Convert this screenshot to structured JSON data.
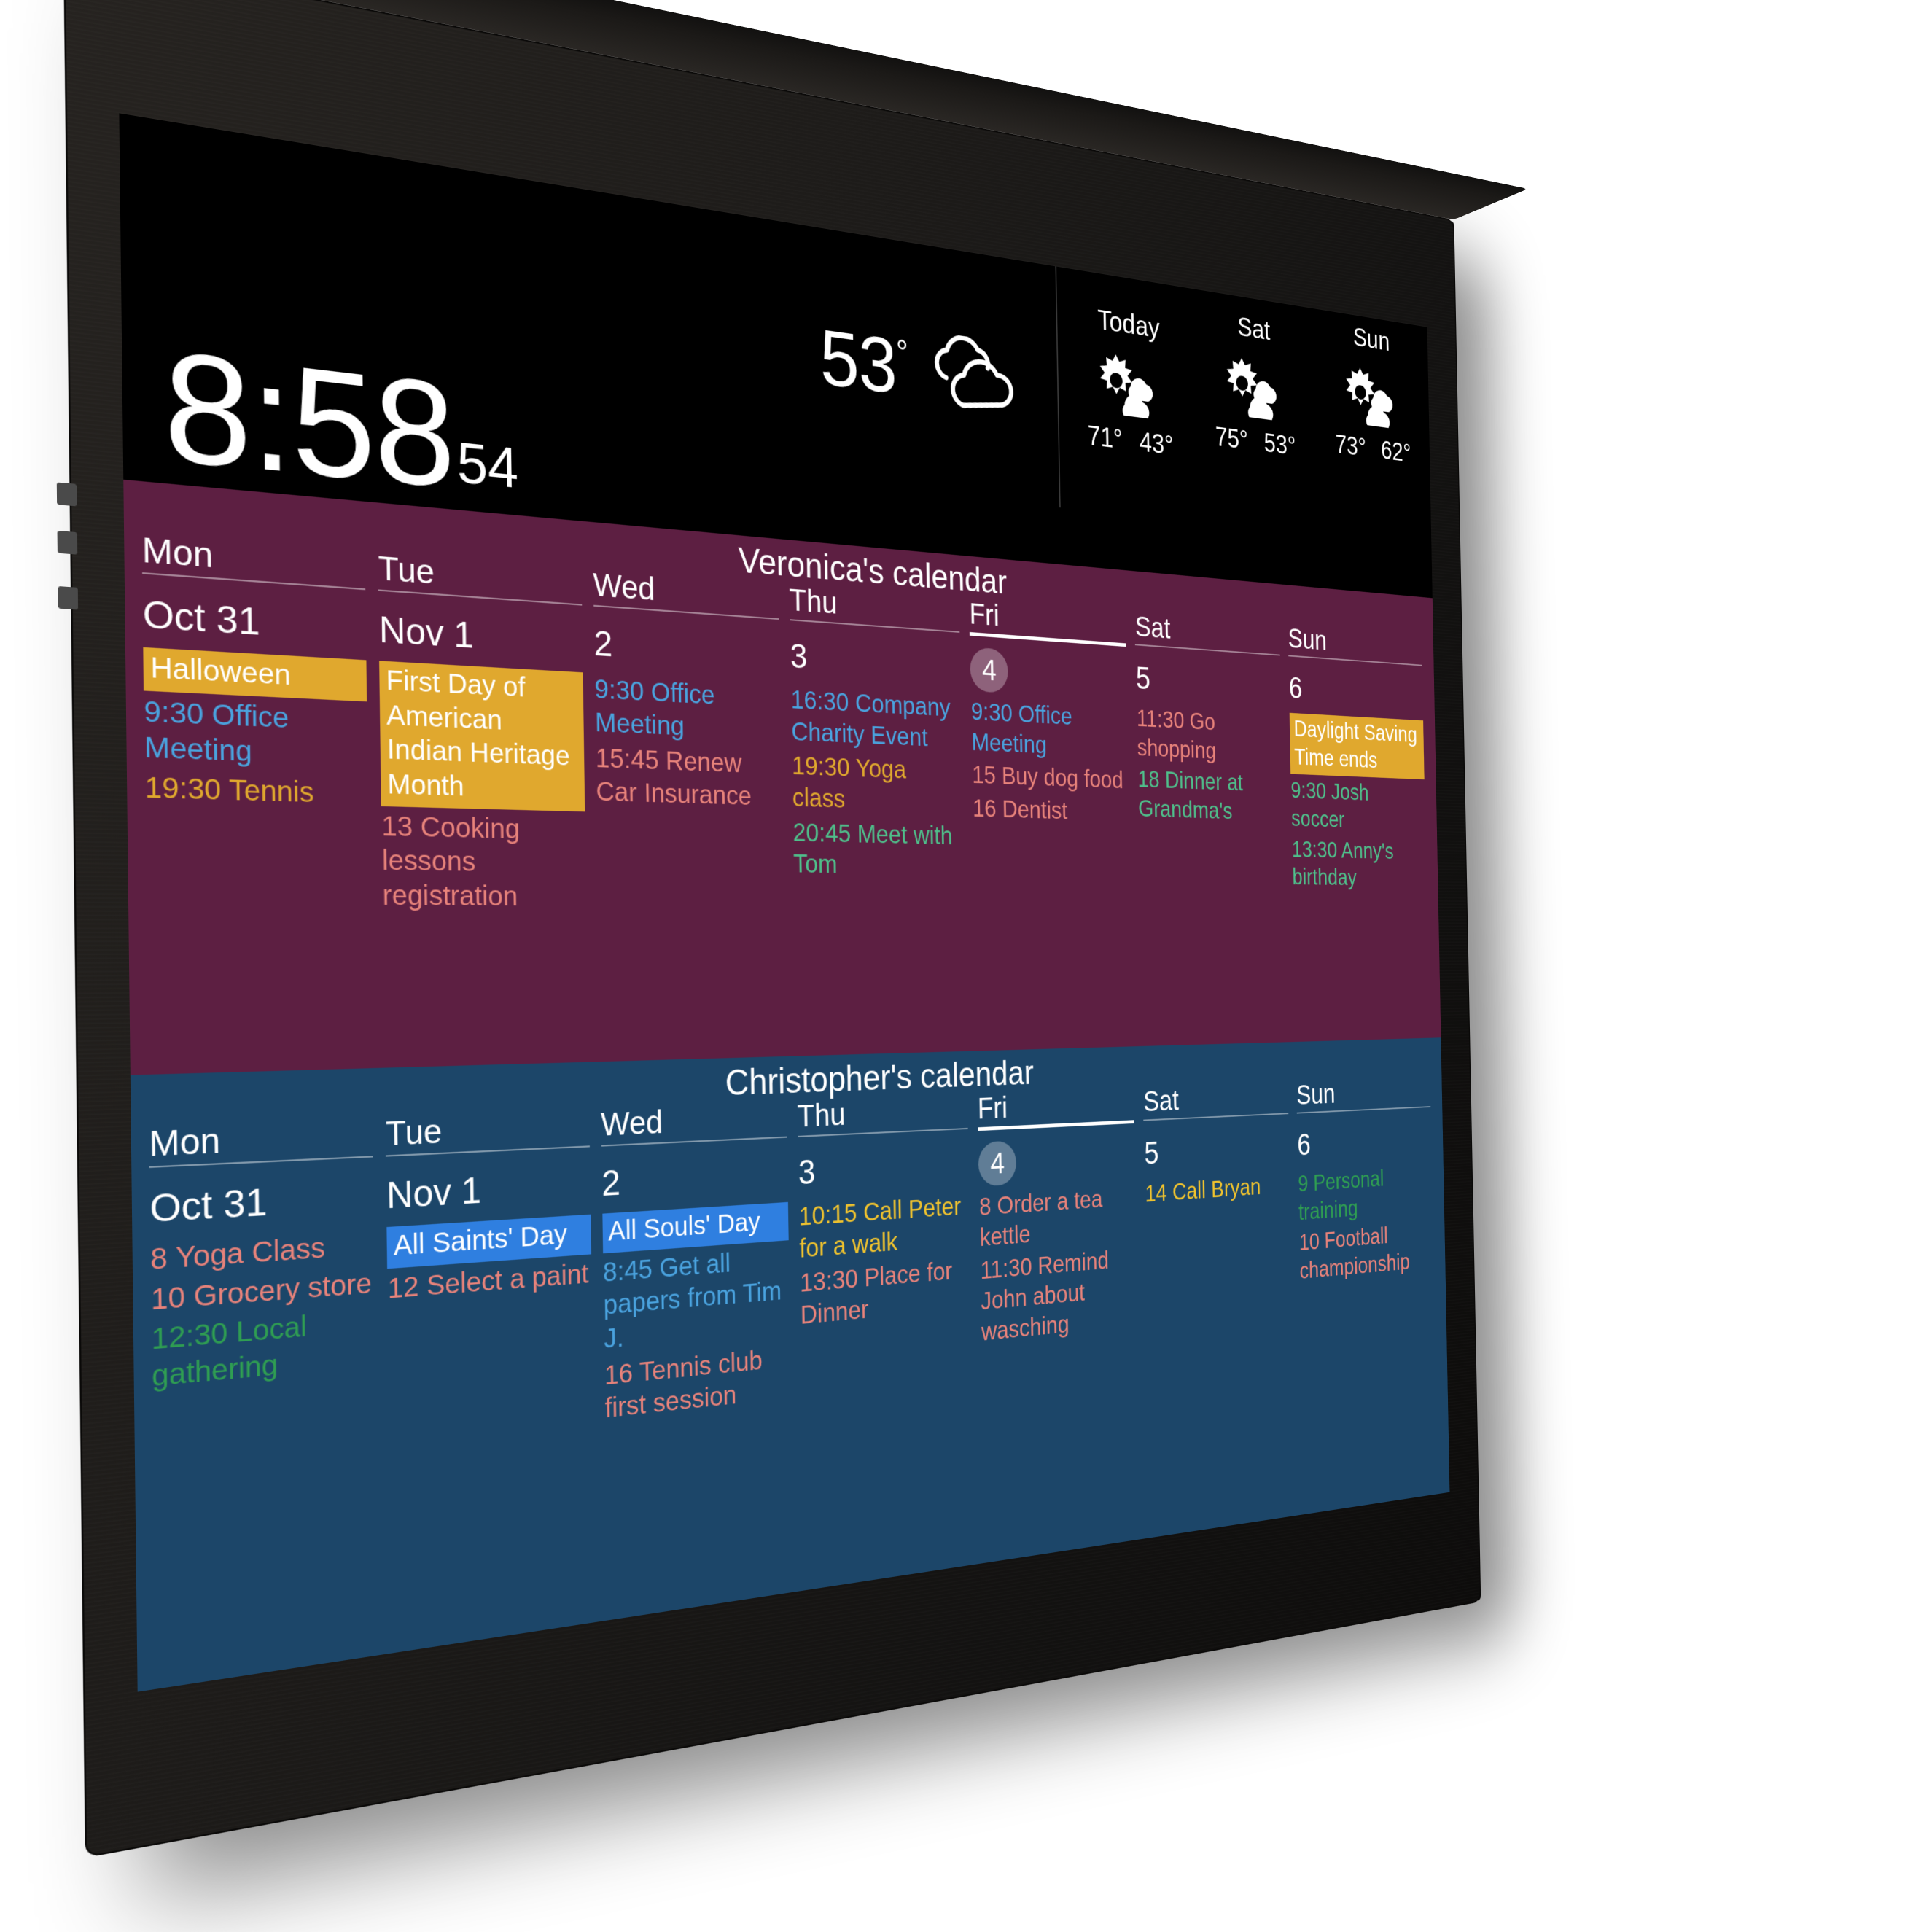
{
  "device": {
    "type": "wall-mounted-smart-display",
    "frame_color": "#1b1917"
  },
  "statusbar": {
    "clock": {
      "time": "8:58",
      "seconds": "54"
    },
    "current_weather": {
      "temperature": "53",
      "degree": "°",
      "icon": "cloudy-icon"
    },
    "forecast": [
      {
        "day": "Today",
        "icon": "partly-cloudy-icon",
        "high": "71°",
        "low": "43°"
      },
      {
        "day": "Sat",
        "icon": "partly-cloudy-icon",
        "high": "75°",
        "low": "53°"
      },
      {
        "day": "Sun",
        "icon": "partly-cloudy-icon",
        "high": "73°",
        "low": "62°"
      }
    ]
  },
  "calendars": [
    {
      "title": "Veronica's calendar",
      "accent": "#5d1f42",
      "days": [
        {
          "dow": "Mon",
          "date": "Oct 31",
          "today": false,
          "events": [
            {
              "text": "Halloween",
              "style": "chip-amber"
            },
            {
              "text": "9:30 Office Meeting",
              "style": "c-blue"
            },
            {
              "text": "19:30 Tennis",
              "style": "c-amber"
            }
          ]
        },
        {
          "dow": "Tue",
          "date": "Nov 1",
          "today": false,
          "events": [
            {
              "text": "First Day of American Indian Heritage Month",
              "style": "chip-amber"
            },
            {
              "text": "13 Cooking lessons registration",
              "style": "c-red"
            }
          ]
        },
        {
          "dow": "Wed",
          "date": "2",
          "today": false,
          "events": [
            {
              "text": "9:30 Office Meeting",
              "style": "c-blue"
            },
            {
              "text": "15:45 Renew Car Insurance",
              "style": "c-red"
            }
          ]
        },
        {
          "dow": "Thu",
          "date": "3",
          "today": false,
          "events": [
            {
              "text": "16:30 Company Charity Event",
              "style": "c-blue"
            },
            {
              "text": "19:30 Yoga class",
              "style": "c-amber"
            },
            {
              "text": "20:45 Meet with Tom",
              "style": "c-green"
            }
          ]
        },
        {
          "dow": "Fri",
          "date": "4",
          "today": true,
          "events": [
            {
              "text": "9:30 Office Meeting",
              "style": "c-blue"
            },
            {
              "text": "15 Buy dog food",
              "style": "c-red"
            },
            {
              "text": "16 Dentist",
              "style": "c-red"
            }
          ]
        },
        {
          "dow": "Sat",
          "date": "5",
          "today": false,
          "events": [
            {
              "text": "11:30 Go shopping",
              "style": "c-red"
            },
            {
              "text": "18 Dinner at Grandma's",
              "style": "c-green"
            }
          ]
        },
        {
          "dow": "Sun",
          "date": "6",
          "today": false,
          "events": [
            {
              "text": "Daylight Saving Time ends",
              "style": "chip-amber"
            },
            {
              "text": "9:30 Josh soccer",
              "style": "c-green"
            },
            {
              "text": "13:30 Anny's birthday",
              "style": "c-green"
            }
          ]
        }
      ]
    },
    {
      "title": "Christopher's calendar",
      "accent": "#1c4669",
      "days": [
        {
          "dow": "Mon",
          "date": "Oct 31",
          "today": false,
          "events": [
            {
              "text": "8 Yoga Class",
              "style": "c-red"
            },
            {
              "text": "10 Grocery store",
              "style": "c-red"
            },
            {
              "text": "12:30 Local gathering",
              "style": "c-green2"
            }
          ]
        },
        {
          "dow": "Tue",
          "date": "Nov 1",
          "today": false,
          "events": [
            {
              "text": "All Saints' Day",
              "style": "chip-blue"
            },
            {
              "text": "12 Select a paint",
              "style": "c-red"
            }
          ]
        },
        {
          "dow": "Wed",
          "date": "2",
          "today": false,
          "events": [
            {
              "text": "All Souls' Day",
              "style": "chip-blue"
            },
            {
              "text": "8:45 Get all papers from Tim J.",
              "style": "c-blue"
            },
            {
              "text": "16 Tennis club first session",
              "style": "c-red"
            }
          ]
        },
        {
          "dow": "Thu",
          "date": "3",
          "today": false,
          "events": [
            {
              "text": "10:15 Call Peter for a walk",
              "style": "c-yellow"
            },
            {
              "text": "13:30 Place for Dinner",
              "style": "c-red"
            }
          ]
        },
        {
          "dow": "Fri",
          "date": "4",
          "today": true,
          "events": [
            {
              "text": "8 Order a tea kettle",
              "style": "c-red"
            },
            {
              "text": "11:30 Remind John about wasching",
              "style": "c-red"
            }
          ]
        },
        {
          "dow": "Sat",
          "date": "5",
          "today": false,
          "events": [
            {
              "text": "14 Call Bryan",
              "style": "c-yellow"
            }
          ]
        },
        {
          "dow": "Sun",
          "date": "6",
          "today": false,
          "events": [
            {
              "text": "9 Personal training",
              "style": "c-green2"
            },
            {
              "text": "10 Football championship",
              "style": "c-red"
            }
          ]
        }
      ]
    }
  ]
}
